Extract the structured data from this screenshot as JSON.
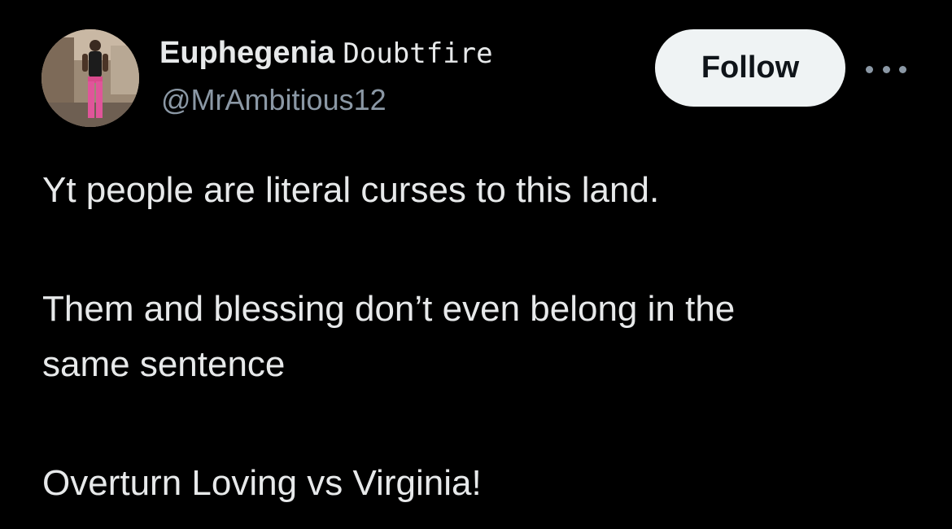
{
  "author": {
    "display_name_bold": "Euphegenia",
    "display_name_mono": "Doubtfire",
    "handle": "@MrAmbitious12",
    "avatar_icon": "avatar-photo-icon"
  },
  "actions": {
    "follow_label": "Follow",
    "more_icon": "more-options-icon"
  },
  "tweet": {
    "lines": [
      "Yt people are literal curses to this land.",
      "Them and blessing don’t even belong in the",
      "same sentence",
      "Overturn Loving vs Virginia!"
    ]
  },
  "colors": {
    "background": "#000000",
    "text_primary": "#e7e9ea",
    "text_secondary": "#8b98a5",
    "follow_bg": "#eff3f4",
    "follow_text": "#0f1419"
  }
}
